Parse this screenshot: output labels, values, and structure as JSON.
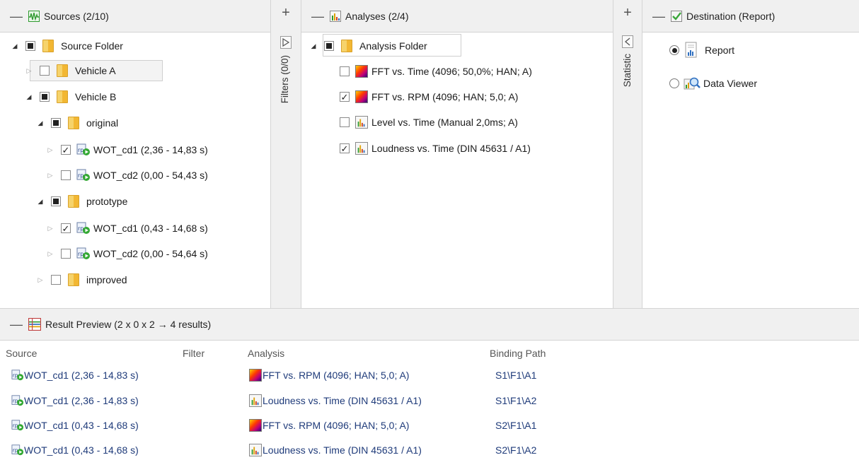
{
  "sources": {
    "title": "Sources (2/10)",
    "tree": [
      {
        "label": "Source Folder"
      },
      {
        "label": "Vehicle A"
      },
      {
        "label": "Vehicle B"
      },
      {
        "label": "original"
      },
      {
        "label": "WOT_cd1 (2,36 - 14,83 s)"
      },
      {
        "label": "WOT_cd2 (0,00 - 54,43 s)"
      },
      {
        "label": "prototype"
      },
      {
        "label": "WOT_cd1 (0,43 - 14,68 s)"
      },
      {
        "label": "WOT_cd2 (0,00 - 54,64 s)"
      },
      {
        "label": "improved"
      }
    ]
  },
  "filters": {
    "plus": "+",
    "label": "Filters (0/0)"
  },
  "analyses": {
    "title": "Analyses (2/4)",
    "tree": [
      {
        "label": "Analysis Folder"
      },
      {
        "label": "FFT vs. Time (4096; 50,0%; HAN; A)"
      },
      {
        "label": "FFT vs. RPM (4096; HAN; 5,0; A)"
      },
      {
        "label": "Level vs. Time (Manual 2,0ms; A)"
      },
      {
        "label": "Loudness vs. Time (DIN 45631 / A1)"
      }
    ]
  },
  "statistic": {
    "plus": "+",
    "label": "Statistic"
  },
  "destination": {
    "title": "Destination (Report)",
    "options": [
      {
        "label": "Report",
        "selected": true
      },
      {
        "label": "Data Viewer",
        "selected": false
      }
    ]
  },
  "result_preview": {
    "title": "Result Preview (2 x 0 x 2 → 4 results)",
    "columns": {
      "source": "Source",
      "filter": "Filter",
      "analysis": "Analysis",
      "binding": "Binding Path"
    },
    "rows": [
      {
        "source": "WOT_cd1 (2,36 - 14,83 s)",
        "analysis": "FFT vs. RPM (4096; HAN; 5,0; A)",
        "analysis_icon": "fft-icon",
        "binding": "S1\\F1\\A1"
      },
      {
        "source": "WOT_cd1 (2,36 - 14,83 s)",
        "analysis": "Loudness vs. Time (DIN 45631 / A1)",
        "analysis_icon": "bar-chart-icon",
        "binding": "S1\\F1\\A2"
      },
      {
        "source": "WOT_cd1 (0,43 - 14,68 s)",
        "analysis": "FFT vs. RPM (4096; HAN; 5,0; A)",
        "analysis_icon": "fft-icon",
        "binding": "S2\\F1\\A1"
      },
      {
        "source": "WOT_cd1 (0,43 - 14,68 s)",
        "analysis": "Loudness vs. Time (DIN 45631 / A1)",
        "analysis_icon": "bar-chart-icon",
        "binding": "S2\\F1\\A2"
      }
    ]
  },
  "colors": {
    "link_text": "#1f3b7a",
    "header_bg": "#f0f0f0",
    "folder": "#f2b733",
    "check_green": "#3aa63a"
  }
}
